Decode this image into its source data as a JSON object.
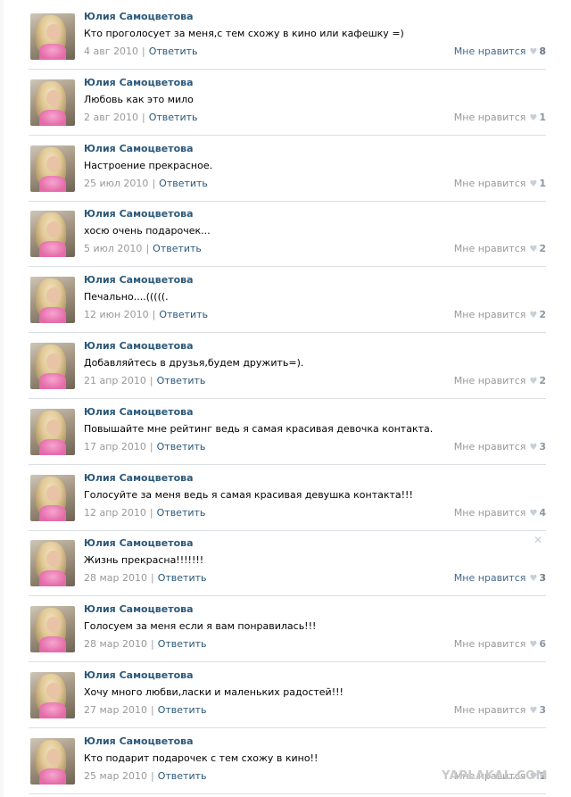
{
  "author": "Юлия Самоцветова",
  "reply_label": "Ответить",
  "like_label": "Мне нравится",
  "watermark": "YAPLAKAL.COM",
  "posts": [
    {
      "text": "Кто проголосует за меня,с тем схожу в кино или кафешку =)",
      "date": "4 авг 2010",
      "likes": "8"
    },
    {
      "text": "Любовь как это мило",
      "date": "2 авг 2010",
      "likes": "1"
    },
    {
      "text": "Настроение прекрасное.",
      "date": "25 июл 2010",
      "likes": "1"
    },
    {
      "text": "хосю очень подарочек...",
      "date": "5 июл 2010",
      "likes": "2"
    },
    {
      "text": "Печально....(((((.",
      "date": "12 июн 2010",
      "likes": "2"
    },
    {
      "text": "Добавляйтесь в друзья,будем дружить=).",
      "date": "21 апр 2010",
      "likes": "2"
    },
    {
      "text": "Повышайте мне рейтинг ведь я самая красивая девочка контакта.",
      "date": "17 апр 2010",
      "likes": "3"
    },
    {
      "text": "Голосуйте за меня ведь я самая красивая девушка контакта!!!",
      "date": "12 апр 2010",
      "likes": "4"
    },
    {
      "text": "Жизнь прекрасна!!!!!!!",
      "date": "28 мар 2010",
      "likes": "3"
    },
    {
      "text": "Голосуем за меня если я вам понравилась!!!",
      "date": "28 мар 2010",
      "likes": "6"
    },
    {
      "text": "Хочу много любви,ласки и маленьких радостей!!!",
      "date": "27 мар 2010",
      "likes": "3"
    },
    {
      "text": "Кто подарит подарочек с тем схожу в кино!!",
      "date": "25 мар 2010",
      "likes": "1"
    }
  ]
}
